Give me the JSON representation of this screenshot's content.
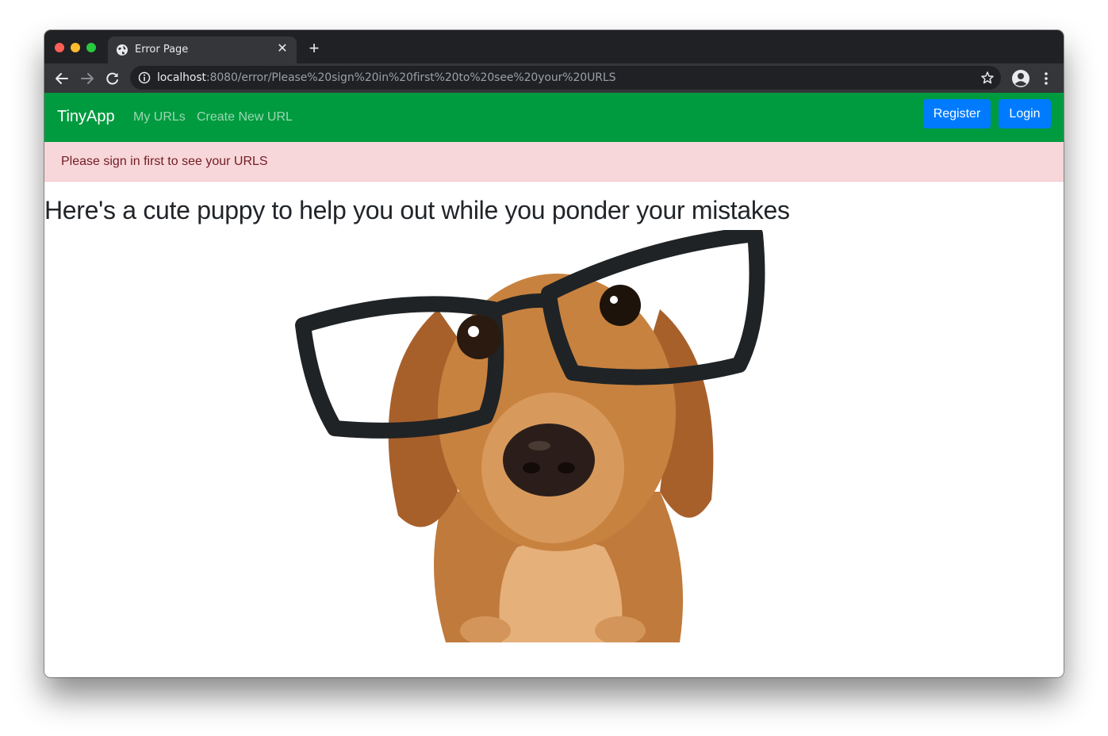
{
  "browser": {
    "tab_title": "Error Page",
    "url_host": "localhost",
    "url_rest": ":8080/error/Please%20sign%20in%20first%20to%20see%20your%20URLS"
  },
  "navbar": {
    "brand": "TinyApp",
    "links": [
      "My URLs",
      "Create New URL"
    ],
    "register_label": "Register",
    "login_label": "Login",
    "color": "#009b3f"
  },
  "alert": {
    "message": "Please sign in first to see your URLS"
  },
  "main": {
    "heading": "Here's a cute puppy to help you out while you ponder your mistakes"
  },
  "icons": [
    "globe-icon",
    "close-icon",
    "plus-icon",
    "back-arrow-icon",
    "forward-arrow-icon",
    "reload-icon",
    "info-icon",
    "star-icon",
    "profile-icon",
    "menu-dots-icon"
  ],
  "colors": {
    "primary_button": "#007bff",
    "alert_bg": "#f8d7da",
    "alert_text": "#721c24"
  }
}
